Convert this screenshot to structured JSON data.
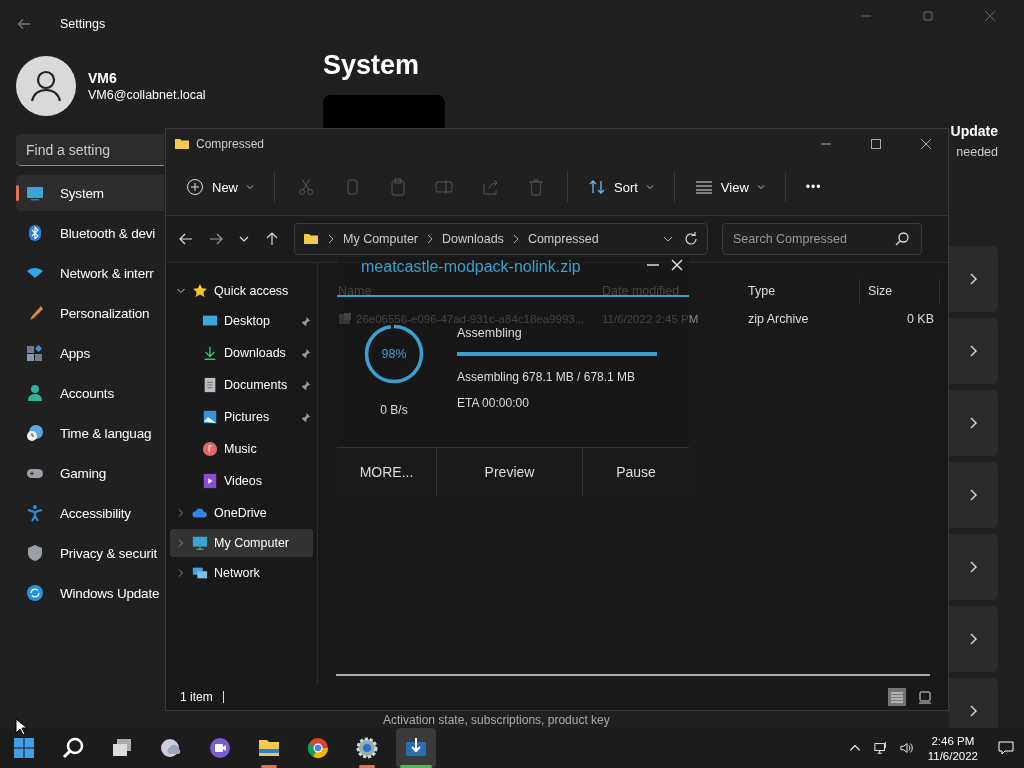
{
  "settings": {
    "title": "Settings",
    "user": {
      "name": "VM6",
      "email": "VM6@collabnet.local"
    },
    "search": {
      "placeholder": "Find a setting"
    },
    "nav": [
      {
        "label": "System",
        "selected": true
      },
      {
        "label": "Bluetooth & devi",
        "selected": false
      },
      {
        "label": "Network & interr",
        "selected": false
      },
      {
        "label": "Personalization",
        "selected": false
      },
      {
        "label": "Apps",
        "selected": false
      },
      {
        "label": "Accounts",
        "selected": false
      },
      {
        "label": "Time & languag",
        "selected": false
      },
      {
        "label": "Gaming",
        "selected": false
      },
      {
        "label": "Accessibility",
        "selected": false
      },
      {
        "label": "Privacy & securit",
        "selected": false
      },
      {
        "label": "Windows Update",
        "selected": false
      }
    ],
    "page_title": "System",
    "update_status": {
      "title": "Update",
      "subtitle": "needed"
    },
    "activation_card": {
      "subtitle": "Activation state, subscriptions, product key"
    }
  },
  "explorer": {
    "title": "Compressed",
    "toolbar": [
      {
        "kind": "menu",
        "label": "New"
      },
      {
        "kind": "icon"
      },
      {
        "kind": "icon"
      },
      {
        "kind": "icon"
      },
      {
        "kind": "icon"
      },
      {
        "kind": "icon"
      },
      {
        "kind": "icon"
      },
      {
        "kind": "menu",
        "label": "Sort"
      },
      {
        "kind": "menu",
        "label": "View"
      },
      {
        "kind": "more",
        "label": "•••"
      }
    ],
    "breadcrumbs": [
      "My Computer",
      "Downloads",
      "Compressed"
    ],
    "search": {
      "placeholder": "Search Compressed"
    },
    "tree": [
      {
        "label": "Quick access",
        "expanded": true,
        "selected": false,
        "children": [
          {
            "label": "Desktop",
            "pinned": true,
            "selected": false
          },
          {
            "label": "Downloads",
            "pinned": true,
            "selected": false
          },
          {
            "label": "Documents",
            "pinned": true,
            "selected": false
          },
          {
            "label": "Pictures",
            "pinned": true,
            "selected": false
          },
          {
            "label": "Music",
            "pinned": false,
            "selected": false
          },
          {
            "label": "Videos",
            "pinned": false,
            "selected": false
          }
        ]
      },
      {
        "label": "OneDrive",
        "expanded": false,
        "selected": false
      },
      {
        "label": "My Computer",
        "expanded": false,
        "selected": true
      },
      {
        "label": "Network",
        "expanded": false,
        "selected": false
      }
    ],
    "columns": [
      "Name",
      "Date modified",
      "Type",
      "Size"
    ],
    "rows": [
      {
        "name": "26e06556-e096-47ad-931c-a84c18ea9993...",
        "date": "11/6/2022 2:45 PM",
        "type": "zip Archive",
        "size": "0 KB"
      }
    ],
    "status": "1 item",
    "view_modes": [
      {
        "selected": true
      },
      {
        "selected": false
      }
    ]
  },
  "download": {
    "title": "meatcastle-modpack-nolink.zip",
    "percent": "98%",
    "level": 0.98,
    "speed": "0 B/s",
    "stage": "Assembling",
    "bar": {
      "level": 1.0
    },
    "detail": "Assembling 678.1 MB / 678.1 MB",
    "eta": "ETA 00:00:00",
    "buttons": [
      "MORE...",
      "Preview",
      "Pause"
    ]
  },
  "taskbar": {
    "apps": [
      {
        "running": false,
        "active": false
      },
      {
        "running": false,
        "active": false
      },
      {
        "running": false,
        "active": false
      },
      {
        "running": false,
        "active": false
      },
      {
        "running": false,
        "active": false
      },
      {
        "running": true,
        "active": false
      },
      {
        "running": false,
        "active": false
      },
      {
        "running": true,
        "active": false
      },
      {
        "running": true,
        "active": true
      }
    ],
    "time": "2:46 PM",
    "date": "11/6/2022"
  }
}
